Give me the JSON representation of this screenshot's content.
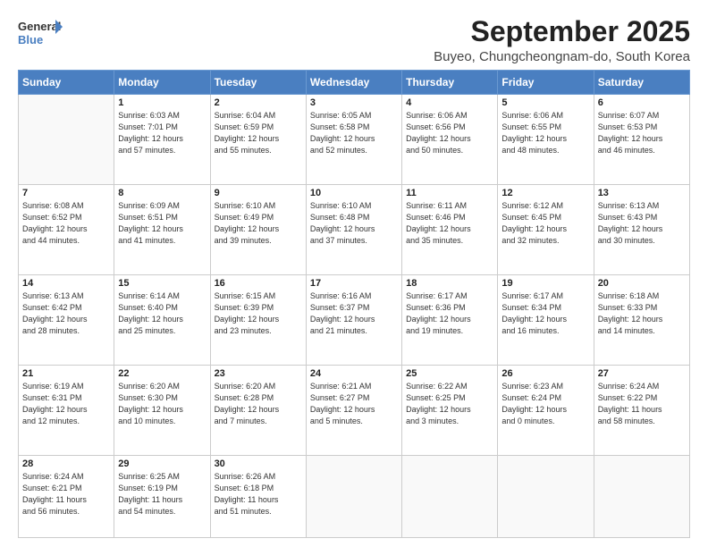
{
  "logo": {
    "line1": "General",
    "line2": "Blue"
  },
  "header": {
    "month": "September 2025",
    "location": "Buyeo, Chungcheongnam-do, South Korea"
  },
  "weekdays": [
    "Sunday",
    "Monday",
    "Tuesday",
    "Wednesday",
    "Thursday",
    "Friday",
    "Saturday"
  ],
  "weeks": [
    [
      {
        "day": "",
        "info": ""
      },
      {
        "day": "1",
        "info": "Sunrise: 6:03 AM\nSunset: 7:01 PM\nDaylight: 12 hours\nand 57 minutes."
      },
      {
        "day": "2",
        "info": "Sunrise: 6:04 AM\nSunset: 6:59 PM\nDaylight: 12 hours\nand 55 minutes."
      },
      {
        "day": "3",
        "info": "Sunrise: 6:05 AM\nSunset: 6:58 PM\nDaylight: 12 hours\nand 52 minutes."
      },
      {
        "day": "4",
        "info": "Sunrise: 6:06 AM\nSunset: 6:56 PM\nDaylight: 12 hours\nand 50 minutes."
      },
      {
        "day": "5",
        "info": "Sunrise: 6:06 AM\nSunset: 6:55 PM\nDaylight: 12 hours\nand 48 minutes."
      },
      {
        "day": "6",
        "info": "Sunrise: 6:07 AM\nSunset: 6:53 PM\nDaylight: 12 hours\nand 46 minutes."
      }
    ],
    [
      {
        "day": "7",
        "info": "Sunrise: 6:08 AM\nSunset: 6:52 PM\nDaylight: 12 hours\nand 44 minutes."
      },
      {
        "day": "8",
        "info": "Sunrise: 6:09 AM\nSunset: 6:51 PM\nDaylight: 12 hours\nand 41 minutes."
      },
      {
        "day": "9",
        "info": "Sunrise: 6:10 AM\nSunset: 6:49 PM\nDaylight: 12 hours\nand 39 minutes."
      },
      {
        "day": "10",
        "info": "Sunrise: 6:10 AM\nSunset: 6:48 PM\nDaylight: 12 hours\nand 37 minutes."
      },
      {
        "day": "11",
        "info": "Sunrise: 6:11 AM\nSunset: 6:46 PM\nDaylight: 12 hours\nand 35 minutes."
      },
      {
        "day": "12",
        "info": "Sunrise: 6:12 AM\nSunset: 6:45 PM\nDaylight: 12 hours\nand 32 minutes."
      },
      {
        "day": "13",
        "info": "Sunrise: 6:13 AM\nSunset: 6:43 PM\nDaylight: 12 hours\nand 30 minutes."
      }
    ],
    [
      {
        "day": "14",
        "info": "Sunrise: 6:13 AM\nSunset: 6:42 PM\nDaylight: 12 hours\nand 28 minutes."
      },
      {
        "day": "15",
        "info": "Sunrise: 6:14 AM\nSunset: 6:40 PM\nDaylight: 12 hours\nand 25 minutes."
      },
      {
        "day": "16",
        "info": "Sunrise: 6:15 AM\nSunset: 6:39 PM\nDaylight: 12 hours\nand 23 minutes."
      },
      {
        "day": "17",
        "info": "Sunrise: 6:16 AM\nSunset: 6:37 PM\nDaylight: 12 hours\nand 21 minutes."
      },
      {
        "day": "18",
        "info": "Sunrise: 6:17 AM\nSunset: 6:36 PM\nDaylight: 12 hours\nand 19 minutes."
      },
      {
        "day": "19",
        "info": "Sunrise: 6:17 AM\nSunset: 6:34 PM\nDaylight: 12 hours\nand 16 minutes."
      },
      {
        "day": "20",
        "info": "Sunrise: 6:18 AM\nSunset: 6:33 PM\nDaylight: 12 hours\nand 14 minutes."
      }
    ],
    [
      {
        "day": "21",
        "info": "Sunrise: 6:19 AM\nSunset: 6:31 PM\nDaylight: 12 hours\nand 12 minutes."
      },
      {
        "day": "22",
        "info": "Sunrise: 6:20 AM\nSunset: 6:30 PM\nDaylight: 12 hours\nand 10 minutes."
      },
      {
        "day": "23",
        "info": "Sunrise: 6:20 AM\nSunset: 6:28 PM\nDaylight: 12 hours\nand 7 minutes."
      },
      {
        "day": "24",
        "info": "Sunrise: 6:21 AM\nSunset: 6:27 PM\nDaylight: 12 hours\nand 5 minutes."
      },
      {
        "day": "25",
        "info": "Sunrise: 6:22 AM\nSunset: 6:25 PM\nDaylight: 12 hours\nand 3 minutes."
      },
      {
        "day": "26",
        "info": "Sunrise: 6:23 AM\nSunset: 6:24 PM\nDaylight: 12 hours\nand 0 minutes."
      },
      {
        "day": "27",
        "info": "Sunrise: 6:24 AM\nSunset: 6:22 PM\nDaylight: 11 hours\nand 58 minutes."
      }
    ],
    [
      {
        "day": "28",
        "info": "Sunrise: 6:24 AM\nSunset: 6:21 PM\nDaylight: 11 hours\nand 56 minutes."
      },
      {
        "day": "29",
        "info": "Sunrise: 6:25 AM\nSunset: 6:19 PM\nDaylight: 11 hours\nand 54 minutes."
      },
      {
        "day": "30",
        "info": "Sunrise: 6:26 AM\nSunset: 6:18 PM\nDaylight: 11 hours\nand 51 minutes."
      },
      {
        "day": "",
        "info": ""
      },
      {
        "day": "",
        "info": ""
      },
      {
        "day": "",
        "info": ""
      },
      {
        "day": "",
        "info": ""
      }
    ]
  ]
}
